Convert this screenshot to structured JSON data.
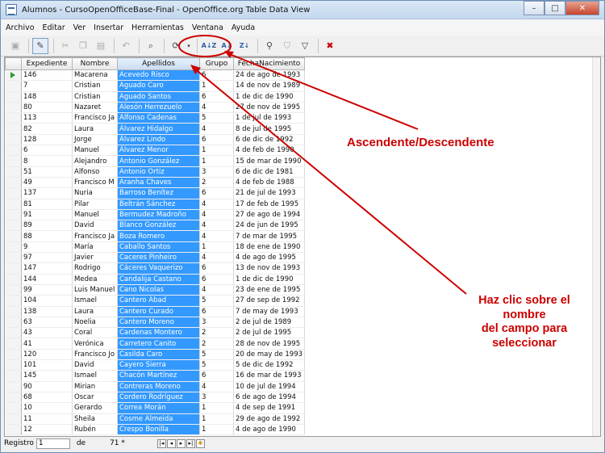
{
  "window": {
    "title": "Alumnos - CursoOpenOfficeBase-Final - OpenOffice.org Table Data View",
    "minimize_icon": "minimize-icon",
    "maximize_icon": "maximize-icon",
    "close_icon": "close-icon"
  },
  "menu": [
    "Archivo",
    "Editar",
    "Ver",
    "Insertar",
    "Herramientas",
    "Ventana",
    "Ayuda"
  ],
  "toolbar": {
    "icons": [
      "save-icon",
      "edit-data-icon",
      "cut-icon",
      "copy-icon",
      "paste-icon",
      "undo-icon",
      "find-icon",
      "refresh-icon",
      "sort-icon",
      "sort-ascending-icon",
      "sort-descending-icon",
      "autofilter-icon",
      "standard-filter-icon",
      "remove-filter-icon",
      "delete-record-icon"
    ]
  },
  "columns": [
    "Expediente",
    "Nombre",
    "Apellidos",
    "Grupo",
    "FechaNacimiento"
  ],
  "rows": [
    [
      "146",
      "Macarena",
      "Acevedo Risco",
      "6",
      "24 de ago de 1993"
    ],
    [
      "7",
      "Cristian",
      "Aguado Caro",
      "1",
      "14 de nov de 1989"
    ],
    [
      "148",
      "Cristian",
      "Aguado Santos",
      "6",
      "1 de dic de 1990"
    ],
    [
      "80",
      "Nazaret",
      "Alesón Herrezuelo",
      "4",
      "27 de nov de 1995"
    ],
    [
      "113",
      "Francisco Ja",
      "Alfonso Cadenas",
      "5",
      "1 de jul de 1993"
    ],
    [
      "82",
      "Laura",
      "Álvarez Hidalgo",
      "4",
      "8 de jul de 1995"
    ],
    [
      "128",
      "Jorge",
      "Álvarez Lindo",
      "6",
      "6 de dic de 1992"
    ],
    [
      "6",
      "Manuel",
      "Álvarez Menor",
      "1",
      "4 de feb de 1990"
    ],
    [
      "8",
      "Alejandro",
      "Antonio González",
      "1",
      "15 de mar de 1990"
    ],
    [
      "51",
      "Alfonso",
      "Antonio Ortiz",
      "3",
      "6 de dic de 1981"
    ],
    [
      "49",
      "Francisco M",
      "Aranha Chaves",
      "2",
      "4 de feb de 1988"
    ],
    [
      "137",
      "Nuria",
      "Barroso Benítez",
      "6",
      "21 de jul de 1993"
    ],
    [
      "81",
      "Pilar",
      "Beltrán Sánchez",
      "4",
      "17 de feb de 1995"
    ],
    [
      "91",
      "Manuel",
      "Bermudez Madroño",
      "4",
      "27 de ago de 1994"
    ],
    [
      "89",
      "David",
      "Blanco González",
      "4",
      "24 de jun de 1995"
    ],
    [
      "88",
      "Francisco Ja",
      "Boza Romero",
      "4",
      "7 de mar de 1995"
    ],
    [
      "9",
      "María",
      "Caballo Santos",
      "1",
      "18 de ene de 1990"
    ],
    [
      "97",
      "Javier",
      "Caceres Pinheiro",
      "4",
      "4 de ago de 1995"
    ],
    [
      "147",
      "Rodrigo",
      "Cáceres Vaquerizo",
      "6",
      "13 de nov de 1993"
    ],
    [
      "144",
      "Medea",
      "Candalija Castano",
      "6",
      "1 de dic de 1990"
    ],
    [
      "99",
      "Luis Manuel",
      "Cano Nicolas",
      "4",
      "23 de ene de 1995"
    ],
    [
      "104",
      "Ismael",
      "Cantero Abad",
      "5",
      "27 de sep de 1992"
    ],
    [
      "138",
      "Laura",
      "Cantero Curado",
      "6",
      "7 de may de 1993"
    ],
    [
      "63",
      "Noelia",
      "Cantero Moreno",
      "3",
      "2 de jul de 1989"
    ],
    [
      "43",
      "Coral",
      "Cardenas Montero",
      "2",
      "2 de jul de 1995"
    ],
    [
      "41",
      "Verónica",
      "Carretero Canito",
      "2",
      "28 de nov de 1995"
    ],
    [
      "120",
      "Francisco Jo",
      "Casilda Caro",
      "5",
      "20 de may de 1993"
    ],
    [
      "101",
      "David",
      "Cayero Sierra",
      "5",
      "5 de dic de 1992"
    ],
    [
      "145",
      "Ismael",
      "Chacón Martínez",
      "6",
      "16 de mar de 1993"
    ],
    [
      "90",
      "Mirian",
      "Contreras Moreno",
      "4",
      "10 de jul de 1994"
    ],
    [
      "68",
      "Oscar",
      "Cordero Rodríguez",
      "3",
      "6 de ago de 1994"
    ],
    [
      "10",
      "Gerardo",
      "Correa Morán",
      "1",
      "4 de sep de 1991"
    ],
    [
      "11",
      "Sheila",
      "Cosme Almeida",
      "1",
      "29 de ago de 1992"
    ],
    [
      "12",
      "Rubén",
      "Crespo Bonilla",
      "1",
      "4 de ago de 1990"
    ]
  ],
  "status": {
    "label": "Registro",
    "current": "1",
    "of_label": "de",
    "total": "71 *"
  },
  "annotations": {
    "sort": "Ascendente/Descendente",
    "click_line1": "Haz clic sobre el",
    "click_line2": "nombre",
    "click_line3": "del campo para",
    "click_line4": "seleccionar"
  },
  "colors": {
    "selection": "#3399ff",
    "annotation": "#cc0000"
  }
}
